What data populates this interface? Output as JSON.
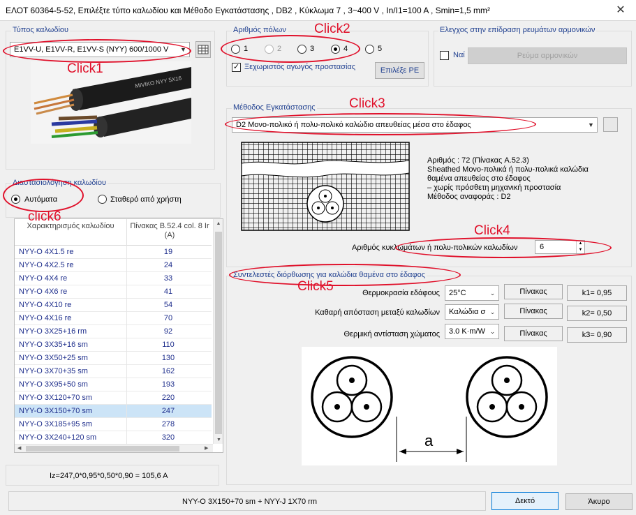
{
  "window": {
    "title": "ΕΛΟΤ 60364-5-52, Επιλέξτε τύπο καλωδίου και Μέθοδο Εγκατάστασης ,  DB2 , Κύκλωμα  7 , 3~400 V , In/I1=100 A , Smin=1,5 mm²",
    "close_glyph": "✕"
  },
  "cable_type": {
    "label": "Τύπος καλωδίου",
    "selected": "E1VV-U, E1VV-R, E1VV-S  (NYY)  600/1000 V",
    "image_text": "MIVIKO NYY 5X16"
  },
  "poles": {
    "label": "Αριθμός πόλων",
    "options": [
      {
        "label": "1",
        "selected": false,
        "enabled": true
      },
      {
        "label": "2",
        "selected": false,
        "enabled": false
      },
      {
        "label": "3",
        "selected": false,
        "enabled": true
      },
      {
        "label": "4",
        "selected": true,
        "enabled": true
      },
      {
        "label": "5",
        "selected": false,
        "enabled": true
      }
    ],
    "pe_checkbox_label": "Ξεχωριστός αγωγός προστασίας",
    "pe_checked": true,
    "pe_button": "Επιλέξε PE"
  },
  "harmonics": {
    "label": "Ελεγχος στην επίδραση ρευμάτων αρμονικών",
    "checkbox_label": "Ναί",
    "button": "Ρεύμα αρμονικών"
  },
  "install_method": {
    "label": "Μέθοδος Εγκατάστασης",
    "selected": "D2   Μονο-πολικό ή πολυ-πολικό καλώδιο απευθείας μέσα στο έδαφος",
    "desc": [
      "Αριθμός : 72 (Πίνακας A.52.3)",
      "Sheathed Μονο-πολικά ή πολυ-πολικά καλώδια",
      "θαμένα απευθείας στο έδαφος",
      "– χωρίς πρόσθετη μηχανική προστασία",
      "Μέθοδος αναφοράς : D2"
    ],
    "count_label": "Αριθμός κυκλωμάτων ή πολυ-πολικών καλωδίων",
    "count_value": "6"
  },
  "sizing": {
    "label": "Διαστασιολόγηση καλωδίου",
    "auto": "Αυτόματα",
    "fixed": "Σταθερό από χρήστη"
  },
  "table": {
    "col1": "Χαρακτηρισμός καλωδίου",
    "col2": "Πίνακας B.52.4 col. 8 Ir (A)",
    "rows": [
      {
        "name": "NYY-O 4X1.5 re",
        "ir": "19"
      },
      {
        "name": "NYY-O 4X2.5 re",
        "ir": "24"
      },
      {
        "name": "NYY-O 4X4 re",
        "ir": "33"
      },
      {
        "name": "NYY-O 4X6 re",
        "ir": "41"
      },
      {
        "name": "NYY-O 4X10 re",
        "ir": "54"
      },
      {
        "name": "NYY-O 4X16 re",
        "ir": "70"
      },
      {
        "name": "NYY-O 3X25+16 rm",
        "ir": "92"
      },
      {
        "name": "NYY-O 3X35+16 sm",
        "ir": "110"
      },
      {
        "name": "NYY-O 3X50+25 sm",
        "ir": "130"
      },
      {
        "name": "NYY-O 3X70+35 sm",
        "ir": "162"
      },
      {
        "name": "NYY-O 3X95+50 sm",
        "ir": "193"
      },
      {
        "name": "NYY-O 3X120+70 sm",
        "ir": "220"
      },
      {
        "name": "NYY-O 3X150+70 sm",
        "ir": "247"
      },
      {
        "name": "NYY-O 3X185+95 sm",
        "ir": "278"
      },
      {
        "name": "NYY-O 3X240+120 sm",
        "ir": "320"
      }
    ]
  },
  "iz_formula": "Iz=247,0*0,95*0,50*0,90 = 105,6 A",
  "correction": {
    "label": "Συντελεστές διόρθωσης για καλώδια θαμένα στο έδαφος",
    "rows": [
      {
        "label": "Θερμοκρασία εδάφους",
        "value": "25°C",
        "btn": "Πίνακας",
        "k": "k1= 0,95"
      },
      {
        "label": "Καθαρή απόσταση μεταξύ καλωδίων",
        "value": "Καλώδια σ",
        "btn": "Πίνακας",
        "k": "k2= 0,50"
      },
      {
        "label": "Θερμική αντίσταση χώματος",
        "value": "3.0 K·m/W",
        "btn": "Πίνακας",
        "k": "k3= 0,90"
      }
    ],
    "diagram_label": "a"
  },
  "status_text": "NYY-O 3X150+70 sm + NYY-J 1X70 rm",
  "ok": "Δεκτό",
  "cancel": "Άκυρο",
  "annotations": [
    "Click1",
    "Click2",
    "Click3",
    "Click4",
    "Click5",
    "click6"
  ],
  "colors": {
    "annotation": "#e0102a",
    "label_blue": "#1f3f8f",
    "selection": "#cce4f7"
  }
}
